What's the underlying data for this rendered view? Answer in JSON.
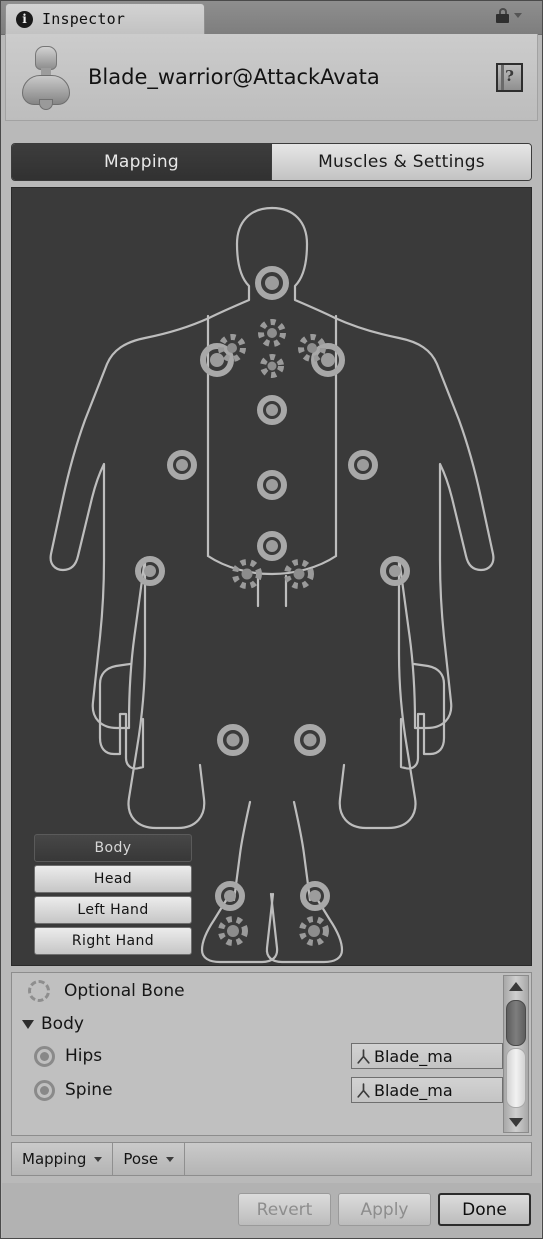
{
  "window": {
    "tab_label": "Inspector",
    "tab_icon": "info-icon",
    "lock_icon": "lock-icon",
    "menu_icon": "chevron-down-icon"
  },
  "object_header": {
    "title": "Blade_warrior@AttackAvata",
    "thumbnail_icon": "avatar-icon",
    "help_icon": "help-book-icon"
  },
  "main_tabs": [
    {
      "label": "Mapping",
      "selected": true
    },
    {
      "label": "Muscles & Settings",
      "selected": false
    }
  ],
  "avatar_view": {
    "body_part_buttons": [
      {
        "label": "Body",
        "selected": true
      },
      {
        "label": "Head",
        "selected": false
      },
      {
        "label": "Left Hand",
        "selected": false
      },
      {
        "label": "Right Hand",
        "selected": false
      }
    ]
  },
  "bone_list": {
    "legend": {
      "label": "Optional Bone",
      "icon": "dashed-circle-icon"
    },
    "group": {
      "label": "Body",
      "expanded": true,
      "icon": "triangle-down-icon"
    },
    "rows": [
      {
        "name": "Hips",
        "value": "Blade_ma",
        "status_icon": "filled-circle-icon",
        "field_icon": "transform-icon",
        "picker_icon": "target-icon"
      },
      {
        "name": "Spine",
        "value": "Blade_ma",
        "status_icon": "filled-circle-icon",
        "field_icon": "transform-icon",
        "picker_icon": "target-icon"
      }
    ],
    "scrollbar": {
      "up_icon": "arrow-up-icon",
      "down_icon": "arrow-down-icon"
    }
  },
  "lower_toolbar": {
    "dropdowns": [
      {
        "label": "Mapping",
        "icon": "caret-down-icon"
      },
      {
        "label": "Pose",
        "icon": "caret-down-icon"
      }
    ]
  },
  "footer": {
    "buttons": [
      {
        "label": "Revert",
        "enabled": false
      },
      {
        "label": "Apply",
        "enabled": false
      },
      {
        "label": "Done",
        "enabled": true
      }
    ]
  },
  "colors": {
    "chrome": "#b9b9b9",
    "canvas": "#3a3a3a",
    "bone_stroke": "#b8b8b8",
    "selected_tab": "#3d3d3d"
  }
}
